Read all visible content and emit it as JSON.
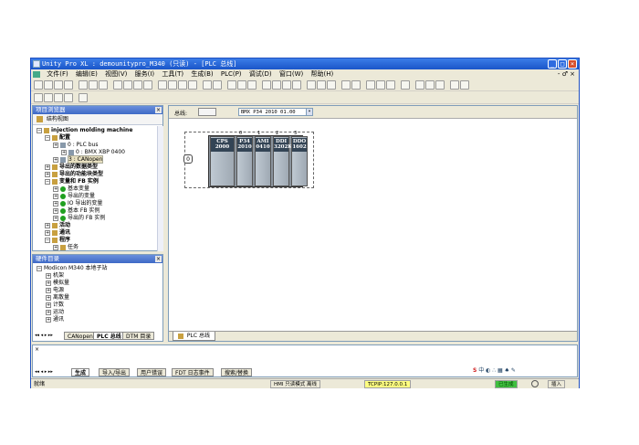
{
  "window": {
    "title": "Unity Pro XL : demounitypro_M340 (只读) - [PLC 总线]"
  },
  "menubar": {
    "items": [
      "文件(F)",
      "编辑(E)",
      "视图(V)",
      "服务(I)",
      "工具(T)",
      "生成(B)",
      "PLC(P)",
      "调试(D)",
      "窗口(W)",
      "帮助(H)"
    ]
  },
  "project_browser": {
    "title": "项目浏览器",
    "view_label": "结构视图",
    "tree": [
      {
        "label": "injection molding machine",
        "level": 0,
        "bold": true
      },
      {
        "label": "配置",
        "level": 1,
        "bold": true
      },
      {
        "label": "0 : PLC bus",
        "level": 2
      },
      {
        "label": "0 : BMX XBP 0400",
        "level": 3
      },
      {
        "label": "3 : CANopen",
        "level": 2
      },
      {
        "label": "导出的数据类型",
        "level": 1,
        "bold": true
      },
      {
        "label": "导出的功能块类型",
        "level": 1,
        "bold": true
      },
      {
        "label": "变量和 FB 实例",
        "level": 1,
        "bold": true
      },
      {
        "label": "基本变量",
        "level": 2
      },
      {
        "label": "导出的变量",
        "level": 2
      },
      {
        "label": "IO 导出的变量",
        "level": 2
      },
      {
        "label": "基本 FB 实例",
        "level": 2
      },
      {
        "label": "导出的 FB 实例",
        "level": 2
      },
      {
        "label": "活动",
        "level": 1,
        "bold": true
      },
      {
        "label": "通讯",
        "level": 1,
        "bold": true
      },
      {
        "label": "程序",
        "level": 1,
        "bold": true
      },
      {
        "label": "任务",
        "level": 2
      }
    ]
  },
  "hardware_catalog": {
    "title": "硬件目录",
    "tree": [
      {
        "label": "Modicon M340 本地子站",
        "level": 0
      },
      {
        "label": "机架",
        "level": 1
      },
      {
        "label": "模拟量",
        "level": 1
      },
      {
        "label": "电源",
        "level": 1
      },
      {
        "label": "离散量",
        "level": 1
      },
      {
        "label": "计数",
        "level": 1
      },
      {
        "label": "运动",
        "level": 1
      },
      {
        "label": "通讯",
        "level": 1
      }
    ],
    "tabs": [
      "CANopen",
      "PLC 总线",
      "DTM 目录"
    ],
    "active_tab": "PLC 总线"
  },
  "editor": {
    "bus_label": "总线:",
    "bus_value": "",
    "rack_select": "BMX P34 2010    01.00",
    "tab_label": "PLC 总线",
    "slot_port": "0",
    "modules": [
      {
        "line1": "CPS",
        "line2": "2000",
        "slot": ""
      },
      {
        "line1": "P34",
        "line2": "2010",
        "slot": "0"
      },
      {
        "line1": "AMI",
        "line2": "0410",
        "slot": "1"
      },
      {
        "line1": "DDI",
        "line2": "3202K",
        "slot": "2"
      },
      {
        "line1": "DDO",
        "line2": "1602",
        "slot": "3"
      }
    ]
  },
  "output": {
    "tabs": [
      "生成",
      "导入/导出",
      "用户错误",
      "FDT 日志事件",
      "搜索/替换"
    ],
    "active_tab": "生成"
  },
  "statusbar": {
    "ready": "就绪",
    "mode": "HMI 只读模式",
    "state": "离线",
    "connection": "TCPIP:127.0.0.1",
    "insert": "插入",
    "built": "已生成"
  },
  "colors": {
    "titlebar": "#1a55c8",
    "connection_bg": "#ffff80",
    "built_bg": "#40c040"
  }
}
